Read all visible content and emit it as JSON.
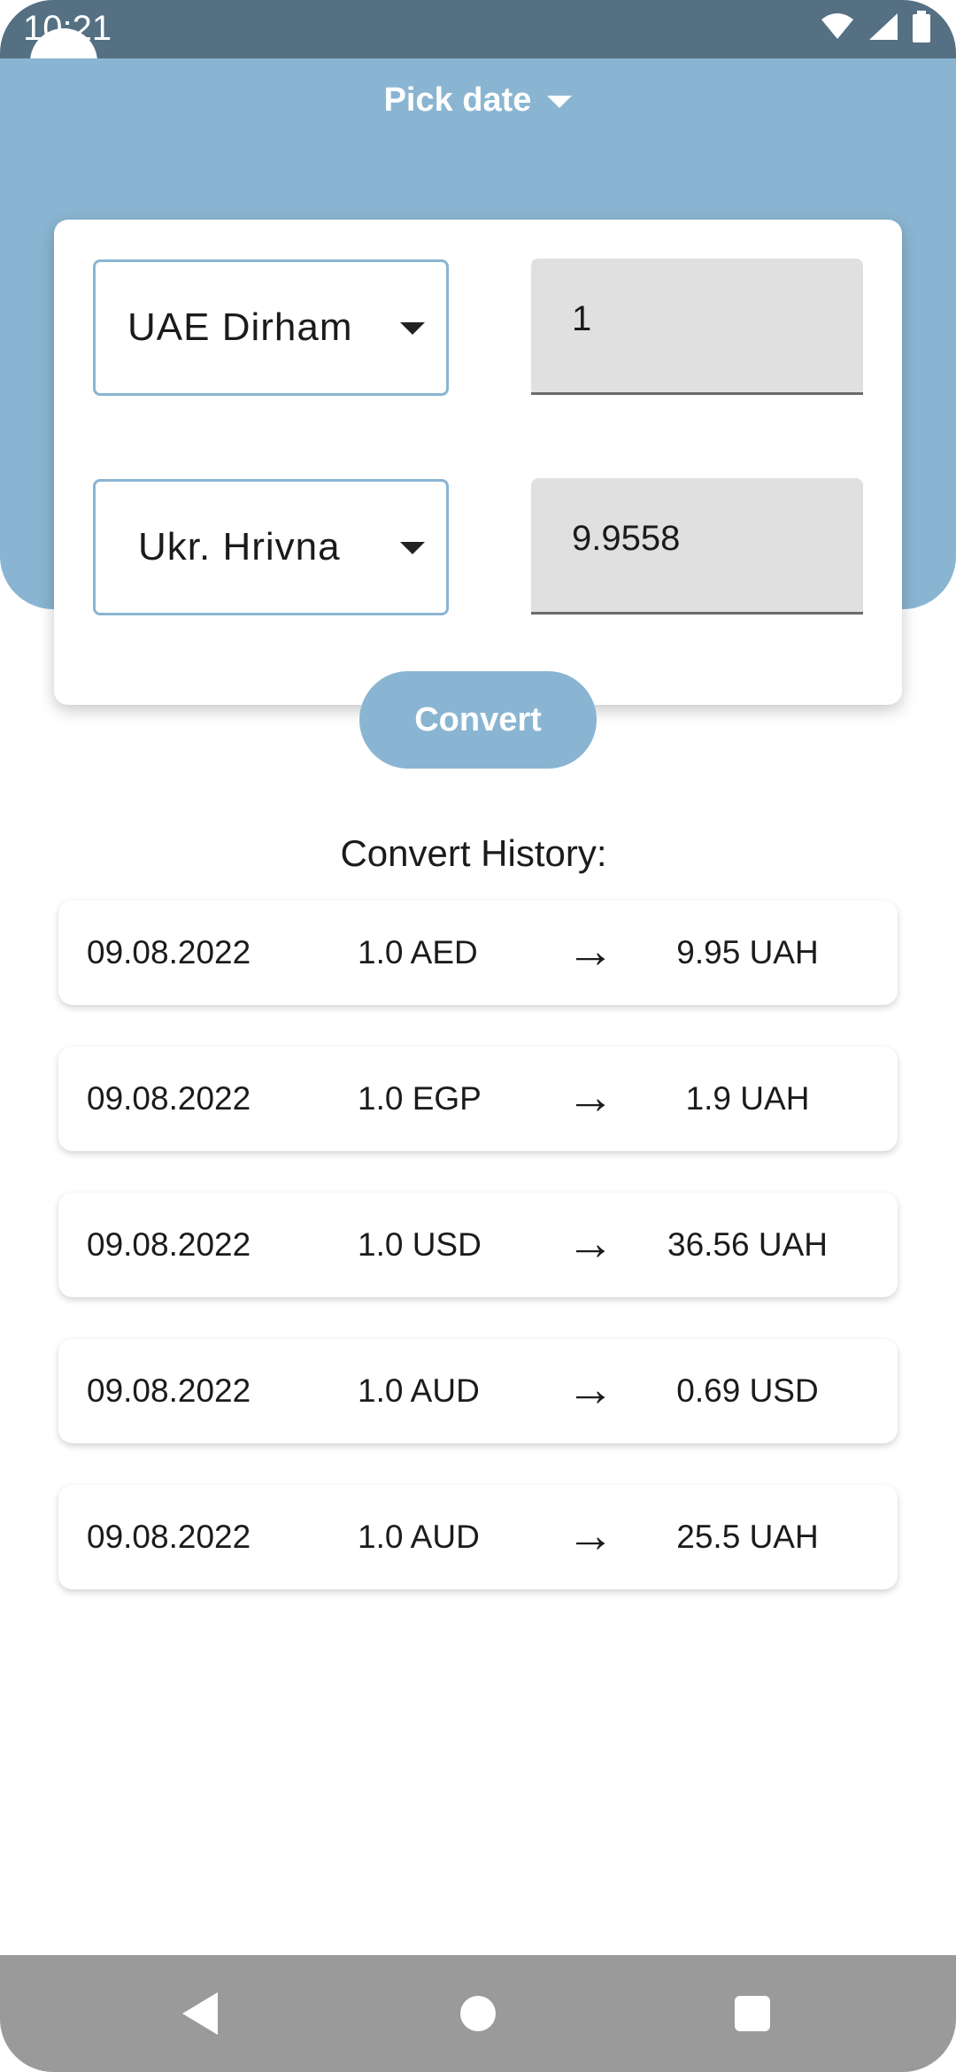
{
  "status_bar": {
    "time": "10:21"
  },
  "header": {
    "pick_date_label": "Pick date"
  },
  "converter": {
    "from_currency": "UAE Dirham",
    "from_amount": "1",
    "to_currency": "Ukr. Hrivna",
    "to_amount": "9.9558",
    "convert_label": "Convert"
  },
  "history": {
    "title": "Convert History:",
    "items": [
      {
        "date": "09.08.2022",
        "from": "1.0  AED",
        "to": "9.95  UAH"
      },
      {
        "date": "09.08.2022",
        "from": "1.0  EGP",
        "to": "1.9  UAH"
      },
      {
        "date": "09.08.2022",
        "from": "1.0  USD",
        "to": "36.56  UAH"
      },
      {
        "date": "09.08.2022",
        "from": "1.0  AUD",
        "to": "0.69  USD"
      },
      {
        "date": "09.08.2022",
        "from": "1.0  AUD",
        "to": "25.5  UAH"
      }
    ]
  },
  "icons": {
    "arrow": "arrow-right-icon",
    "wifi": "wifi-icon",
    "signal": "signal-icon",
    "battery": "battery-icon"
  },
  "colors": {
    "accent": "#8ab5d2",
    "status_bar": "#557083",
    "nav_bar": "#9a9a9a"
  }
}
